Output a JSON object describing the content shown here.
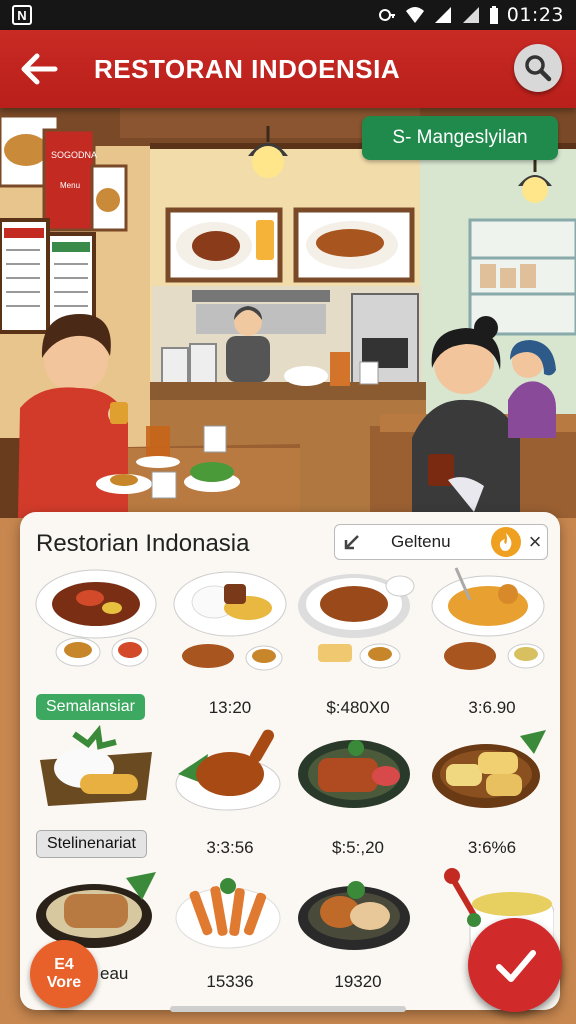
{
  "status_bar": {
    "left_icon": "N",
    "time": "01:23",
    "icons": [
      "vpn-key-icon",
      "wifi-icon",
      "signal-icon",
      "signal-icon",
      "battery-icon"
    ]
  },
  "app_bar": {
    "title": "RESTORAN INDOENSIA",
    "back_icon": "arrow-left-icon",
    "search_icon": "search-icon"
  },
  "scene": {
    "badge": "S- Mangeslyilan",
    "sign_text": "SOGODNA",
    "sign_sub": "Menu"
  },
  "panel": {
    "title": "Restorian Indonasia",
    "search_text": "Geltenu",
    "search_icon": "arrow-diagonal-icon",
    "fire_icon": "fire-icon",
    "close_label": "×"
  },
  "categories": [
    "Semalansiar",
    "Stelinenariat"
  ],
  "items": [
    {
      "name": "rendang-plate",
      "price": ""
    },
    {
      "name": "rice-satay-plate",
      "price": ""
    },
    {
      "name": "noodle-plate",
      "price": ""
    },
    {
      "name": "mie-goreng-plate",
      "price": ""
    },
    {
      "name": "satay-bowl",
      "price": ""
    },
    {
      "name": "satay-soup",
      "price": "13:20"
    },
    {
      "name": "spring-roll-soup",
      "price": "$:480X0"
    },
    {
      "name": "fried-item-soup",
      "price": "3:6.90"
    },
    {
      "name": "nasi-lemak",
      "price": ""
    },
    {
      "name": "ayam-goreng",
      "price": "3:3:56"
    },
    {
      "name": "grilled-fish",
      "price": "$:5:,20"
    },
    {
      "name": "lumpia",
      "price": "3:6%6"
    },
    {
      "name": "grilled-roll",
      "price": ""
    },
    {
      "name": "fries-plate",
      "price": "15336"
    },
    {
      "name": "fried-chicken-plate",
      "price": "19320"
    },
    {
      "name": "soup-bowl",
      "price": ""
    }
  ],
  "fab_left": {
    "line1": "E4",
    "line2": "Vore",
    "line3": "eau"
  },
  "fab_right_icon": "check-icon",
  "colors": {
    "brand_red": "#c92a24",
    "accent_green": "#1f8a4c",
    "accent_orange": "#e8602a"
  }
}
